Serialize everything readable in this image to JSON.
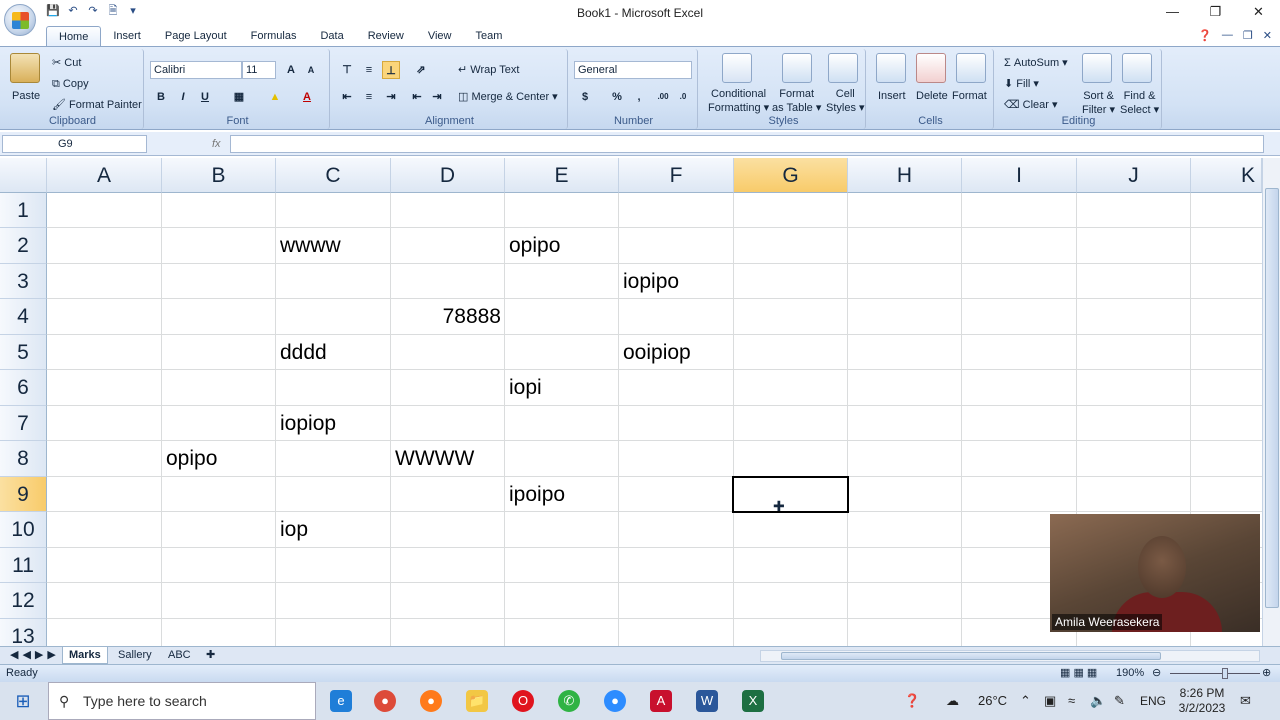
{
  "window": {
    "title": "Book1 - Microsoft Excel"
  },
  "ribbon_tabs": [
    "Home",
    "Insert",
    "Page Layout",
    "Formulas",
    "Data",
    "Review",
    "View",
    "Team"
  ],
  "clipboard": {
    "paste": "Paste",
    "cut": "Cut",
    "copy": "Copy",
    "format_painter": "Format Painter",
    "label": "Clipboard"
  },
  "font": {
    "name": "Calibri",
    "size": "11",
    "bold": "B",
    "italic": "I",
    "underline": "U",
    "label": "Font"
  },
  "alignment": {
    "wrap": "Wrap Text",
    "merge": "Merge & Center",
    "label": "Alignment"
  },
  "number": {
    "format": "General",
    "percent": "%",
    "comma": ",",
    "label": "Number"
  },
  "styles": {
    "conditional_1": "Conditional",
    "conditional_2": "Formatting",
    "format_table_1": "Format",
    "format_table_2": "as Table",
    "cell_styles_1": "Cell",
    "cell_styles_2": "Styles",
    "label": "Styles"
  },
  "cells": {
    "insert": "Insert",
    "delete": "Delete",
    "format": "Format",
    "label": "Cells"
  },
  "editing": {
    "autosum": "AutoSum",
    "fill": "Fill",
    "clear": "Clear",
    "sort_1": "Sort &",
    "sort_2": "Filter",
    "find_1": "Find &",
    "find_2": "Select",
    "label": "Editing"
  },
  "formula_bar": {
    "name_box": "G9",
    "fx": "fx",
    "formula": ""
  },
  "columns": [
    "A",
    "B",
    "C",
    "D",
    "E",
    "F",
    "G",
    "H",
    "I",
    "J",
    "K"
  ],
  "rows": [
    "1",
    "2",
    "3",
    "4",
    "5",
    "6",
    "7",
    "8",
    "9",
    "10",
    "11",
    "12",
    "13"
  ],
  "cells_data": [
    {
      "ref": "C2",
      "value": "wwww"
    },
    {
      "ref": "E2",
      "value": "opipo"
    },
    {
      "ref": "F3",
      "value": "iopipo"
    },
    {
      "ref": "D4",
      "value": "78888"
    },
    {
      "ref": "C5",
      "value": "dddd"
    },
    {
      "ref": "F5",
      "value": "ooipiop"
    },
    {
      "ref": "E6",
      "value": "iopi"
    },
    {
      "ref": "C7",
      "value": "iopiop"
    },
    {
      "ref": "B8",
      "value": "opipo"
    },
    {
      "ref": "D8",
      "value": "WWWW"
    },
    {
      "ref": "E9",
      "value": "ipoipo"
    },
    {
      "ref": "C10",
      "value": "iop"
    }
  ],
  "sheets": [
    "Marks",
    "Sallery",
    "ABC"
  ],
  "status": {
    "ready": "Ready",
    "zoom": "190%"
  },
  "video": {
    "name": "Amila Weerasekera"
  },
  "taskbar": {
    "search_placeholder": "Type here to search",
    "temp": "26°C",
    "lang": "ENG",
    "time": "8:26 PM",
    "date": "3/2/2023"
  }
}
